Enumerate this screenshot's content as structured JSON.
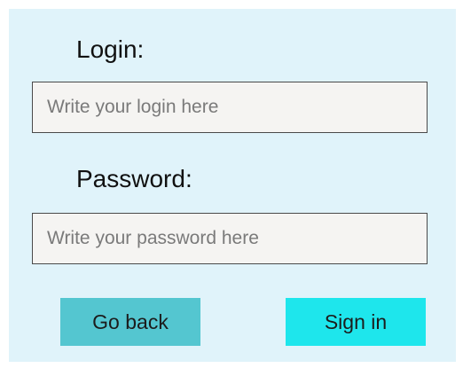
{
  "form": {
    "login_label": "Login:",
    "login_placeholder": "Write your login here",
    "login_value": "",
    "password_label": "Password:",
    "password_placeholder": "Write your password here",
    "password_value": ""
  },
  "actions": {
    "back_label": "Go back",
    "signin_label": "Sign in"
  },
  "colors": {
    "panel_background": "#e0f3fa",
    "input_background": "#f5f4f2",
    "back_button": "#54c6d0",
    "signin_button": "#1ee6ec"
  }
}
